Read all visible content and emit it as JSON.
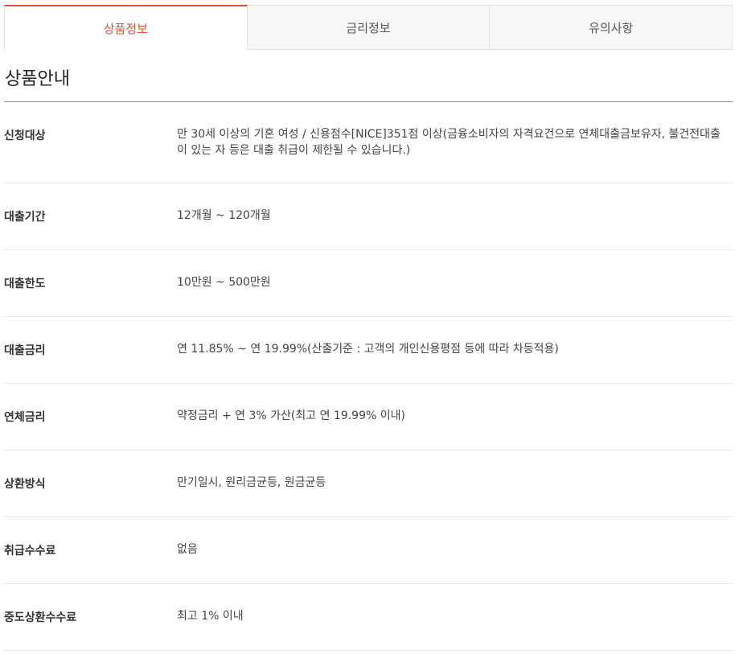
{
  "tabs": [
    {
      "label": "상품정보",
      "active": true
    },
    {
      "label": "금리정보",
      "active": false
    },
    {
      "label": "유의사항",
      "active": false
    }
  ],
  "section": {
    "title": "상품안내"
  },
  "rows": [
    {
      "label": "신청대상",
      "value": "만 30세 이상의 기혼 여성 / 신용점수[NICE]351점 이상(금융소비자의 자격요건으로 연체대출금보유자, 불건전대출이 있는 자 등은 대출 취급이 제한될 수 있습니다.)"
    },
    {
      "label": "대출기간",
      "value": "12개월 ~ 120개월"
    },
    {
      "label": "대출한도",
      "value": "10만원 ~ 500만원"
    },
    {
      "label": "대출금리",
      "value": "연 11.85% ~  연 19.99%(산출기준 : 고객의 개인신용평점 등에 따라 차등적용)"
    },
    {
      "label": "연체금리",
      "value": "약정금리 + 연 3% 가산(최고 연 19.99% 이내)"
    },
    {
      "label": "상환방식",
      "value": "만기일시, 원리금균등, 원금균등"
    },
    {
      "label": "취급수수료",
      "value": "없음"
    },
    {
      "label": "중도상환수수료",
      "value": "최고 1% 이내"
    }
  ],
  "colors": {
    "accent": "#e4502f",
    "divider": "#e6e6e6",
    "title_rule": "#8a8a8a"
  }
}
